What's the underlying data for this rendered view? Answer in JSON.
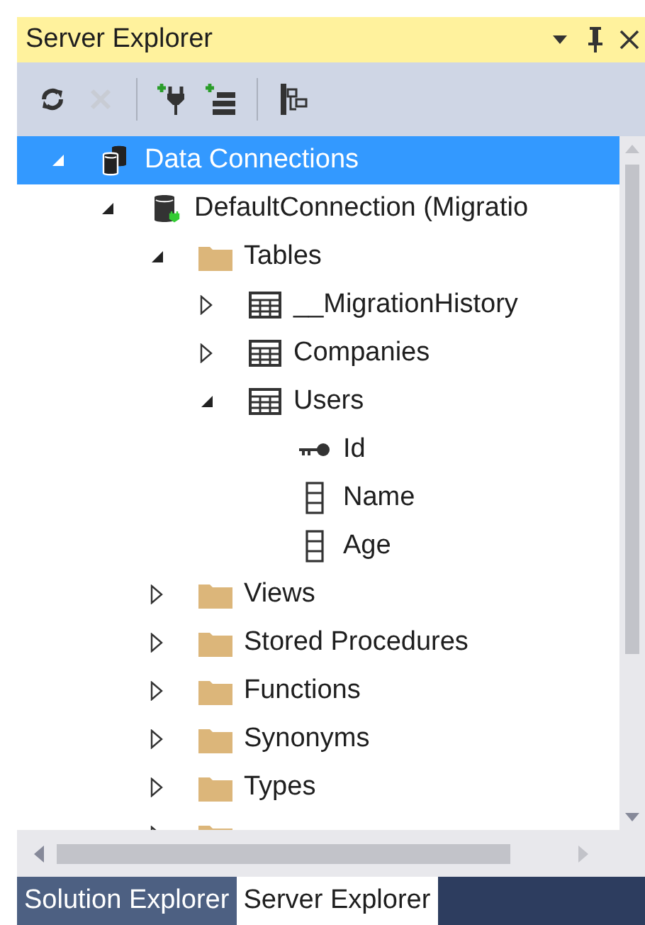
{
  "window": {
    "title": "Server Explorer"
  },
  "toolbar": [
    {
      "kind": "refresh",
      "disabled": false
    },
    {
      "kind": "delete",
      "disabled": true
    },
    {
      "kind": "separator"
    },
    {
      "kind": "connect",
      "disabled": false
    },
    {
      "kind": "add-server",
      "disabled": false
    },
    {
      "kind": "separator"
    },
    {
      "kind": "schema",
      "disabled": false
    }
  ],
  "tree": [
    {
      "label": "Data Connections",
      "kind": "databases",
      "expanded": true,
      "selected": true,
      "children": [
        {
          "label": "DefaultConnection (Migratio",
          "kind": "database",
          "expanded": true,
          "selected": false,
          "children": [
            {
              "label": "Tables",
              "kind": "folder",
              "expanded": true,
              "selected": false,
              "children": [
                {
                  "label": "__MigrationHistory",
                  "kind": "table",
                  "expanded": false,
                  "selected": false
                },
                {
                  "label": "Companies",
                  "kind": "table",
                  "expanded": false,
                  "selected": false
                },
                {
                  "label": "Users",
                  "kind": "table",
                  "expanded": true,
                  "selected": false,
                  "children": [
                    {
                      "label": "Id",
                      "kind": "key",
                      "selected": false
                    },
                    {
                      "label": "Name",
                      "kind": "column",
                      "selected": false
                    },
                    {
                      "label": "Age",
                      "kind": "column",
                      "selected": false
                    }
                  ]
                }
              ]
            },
            {
              "label": "Views",
              "kind": "folder",
              "expanded": false,
              "selected": false
            },
            {
              "label": "Stored Procedures",
              "kind": "folder",
              "expanded": false,
              "selected": false
            },
            {
              "label": "Functions",
              "kind": "folder",
              "expanded": false,
              "selected": false
            },
            {
              "label": "Synonyms",
              "kind": "folder",
              "expanded": false,
              "selected": false
            },
            {
              "label": "Types",
              "kind": "folder",
              "expanded": false,
              "selected": false
            },
            {
              "kind": "folder",
              "expanded": false,
              "selected": false
            }
          ]
        }
      ]
    }
  ],
  "bottom_tabs": [
    {
      "label": "Solution Explorer",
      "selected": false
    },
    {
      "label": "Server Explorer",
      "selected": true
    }
  ]
}
